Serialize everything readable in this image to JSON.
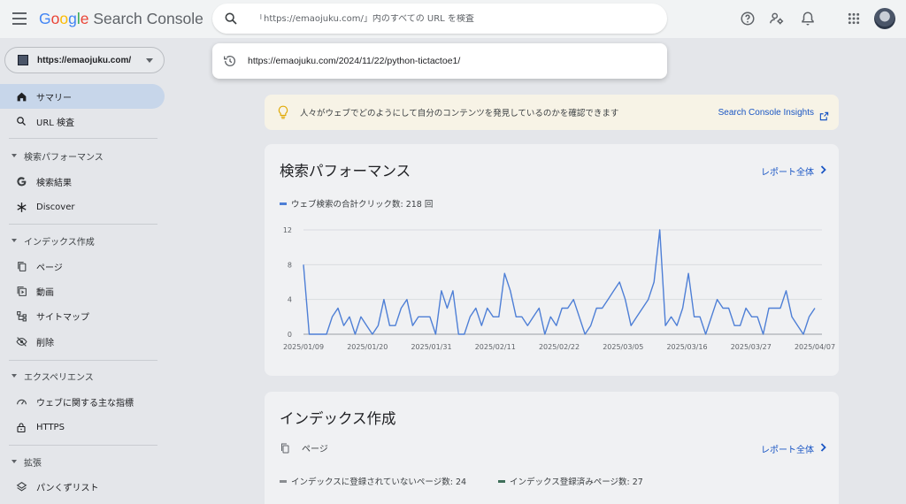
{
  "header": {
    "logo_letters": [
      "G",
      "o",
      "o",
      "g",
      "l",
      "e"
    ],
    "logo_rest": " Search Console"
  },
  "search": {
    "placeholder": "「https://emaojuku.com/」内のすべての URL を検査",
    "suggestion": "https://emaojuku.com/2024/11/22/python-tictactoe1/"
  },
  "property": {
    "label": "https://emaojuku.com/"
  },
  "sidebar": {
    "items": [
      {
        "label": "サマリー"
      },
      {
        "label": "URL 検査"
      },
      {
        "label": "検索パフォーマンス"
      },
      {
        "label": "検索結果"
      },
      {
        "label": "Discover"
      },
      {
        "label": "インデックス作成"
      },
      {
        "label": "ページ"
      },
      {
        "label": "動画"
      },
      {
        "label": "サイトマップ"
      },
      {
        "label": "削除"
      },
      {
        "label": "エクスペリエンス"
      },
      {
        "label": "ウェブに関する主な指標"
      },
      {
        "label": "HTTPS"
      },
      {
        "label": "拡張"
      },
      {
        "label": "パンくずリスト"
      }
    ]
  },
  "banner": {
    "text": "人々がウェブでどのようにして自分のコンテンツを発見しているのかを確認できます",
    "link": "Search Console Insights"
  },
  "performance": {
    "title": "検索パフォーマンス",
    "report_link": "レポート全体",
    "legend": "ウェブ検索の合計クリック数: 218 回"
  },
  "indexing": {
    "title": "インデックス作成",
    "sub": "ページ",
    "report_link": "レポート全体",
    "not_indexed": "インデックスに登録されていないページ数: 24",
    "indexed": "インデックス登録済みページ数: 27"
  },
  "colors": {
    "series": "#4e7fd6",
    "link": "#1a56c4",
    "not_indexed": "#8a8d91",
    "indexed": "#3f6f5a"
  },
  "chart_data": {
    "type": "line",
    "series": [
      {
        "name": "ウェブ検索の合計クリック数",
        "values": [
          8,
          0,
          0,
          0,
          0,
          2,
          3,
          1,
          2,
          0,
          2,
          1,
          0,
          1,
          4,
          1,
          1,
          3,
          4,
          1,
          2,
          2,
          2,
          0,
          5,
          3,
          5,
          0,
          0,
          2,
          3,
          1,
          3,
          2,
          2,
          7,
          5,
          2,
          2,
          1,
          2,
          3,
          0,
          2,
          1,
          3,
          3,
          4,
          2,
          0,
          1,
          3,
          3,
          4,
          5,
          6,
          4,
          1,
          2,
          3,
          4,
          6,
          12,
          1,
          2,
          1,
          3,
          7,
          2,
          2,
          0,
          2,
          4,
          3,
          3,
          1,
          1,
          3,
          2,
          2,
          0,
          3,
          3,
          3,
          5,
          2,
          1,
          0,
          2,
          3
        ]
      }
    ],
    "x_start": "2025/01/09",
    "x_end": "2025/04/08",
    "x_tick_labels": [
      "2025/01/09",
      "2025/01/20",
      "2025/01/31",
      "2025/02/11",
      "2025/02/22",
      "2025/03/05",
      "2025/03/16",
      "2025/03/27",
      "2025/04/07"
    ],
    "y_ticks": [
      0,
      4,
      8,
      12
    ],
    "ylim": [
      0,
      12
    ],
    "grid": true
  }
}
